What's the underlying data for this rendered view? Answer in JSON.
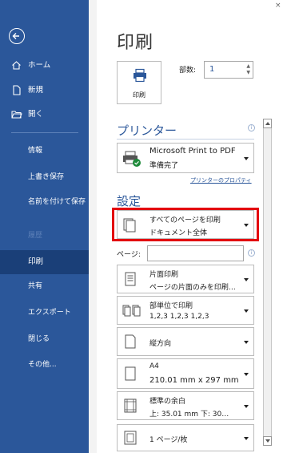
{
  "window": {
    "close_glyph": "×"
  },
  "sidebar": {
    "home_label": "ホーム",
    "new_label": "新規",
    "open_label": "開く",
    "sub_items": [
      "情報",
      "上書き保存",
      "名前を付けて保存",
      "履歴",
      "印刷",
      "共有",
      "エクスポート",
      "閉じる",
      "その他..."
    ],
    "active_item": "印刷"
  },
  "main": {
    "title": "印刷",
    "print_button_label": "印刷",
    "copies_label": "部数:",
    "copies_value": "1",
    "printer_heading": "プリンター",
    "printer": {
      "name": "Microsoft Print to PDF",
      "status": "準備完了"
    },
    "printer_properties_link": "プリンターのプロパティ",
    "settings_heading": "設定",
    "settings": [
      {
        "line1": "すべてのページを印刷",
        "line2": "ドキュメント全体",
        "icon": "pages-icon"
      },
      {
        "line1": "片面印刷",
        "line2": "ページの片面のみを印刷…",
        "icon": "one-sided-icon"
      },
      {
        "line1": "部単位で印刷",
        "line2": "1,2,3   1,2,3   1,2,3",
        "icon": "collate-icon"
      },
      {
        "line1": "縦方向",
        "line2": "",
        "icon": "portrait-icon"
      },
      {
        "line1": "A4",
        "line2": "210.01 mm x 297 mm",
        "icon": "paper-size-icon"
      },
      {
        "line1": "標準の余白",
        "line2": "上: 35.01 mm 下: 30…",
        "icon": "margins-icon"
      },
      {
        "line1": "1 ページ/枚",
        "line2": "",
        "icon": "pages-per-sheet-icon"
      }
    ],
    "pages_label": "ページ:",
    "pages_value": ""
  },
  "colors": {
    "sidebar": "#2b579a",
    "active": "#1a3f78",
    "highlight": "#e3000f",
    "accent": "#2b579a"
  }
}
